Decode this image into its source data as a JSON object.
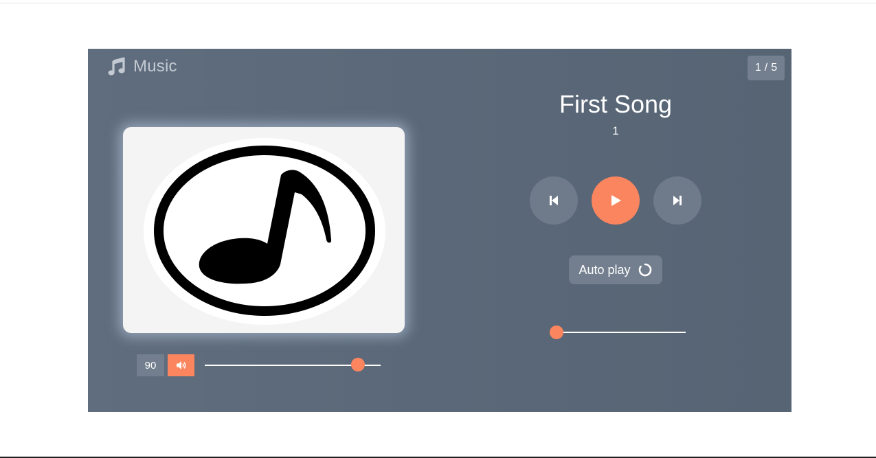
{
  "app": {
    "title": "Music",
    "icon": "music-note-icon"
  },
  "counter": {
    "current": "1",
    "separator": "/",
    "total": "5"
  },
  "song": {
    "title": "First Song",
    "artist": "1",
    "cover_icon": "music-note-disc-icon"
  },
  "controls": {
    "prev_icon": "skip-previous-icon",
    "play_icon": "play-icon",
    "next_icon": "skip-next-icon"
  },
  "autoplay": {
    "label": "Auto play",
    "icon": "loop-icon"
  },
  "volume": {
    "value": "90",
    "level": 0.87,
    "icon": "speaker-volume-icon"
  },
  "progress": {
    "fraction": 0.03
  },
  "colors": {
    "accent": "#fa855e",
    "panel": "#5b6a7b",
    "button_muted": "#737f8e",
    "text": "#ffffff"
  }
}
